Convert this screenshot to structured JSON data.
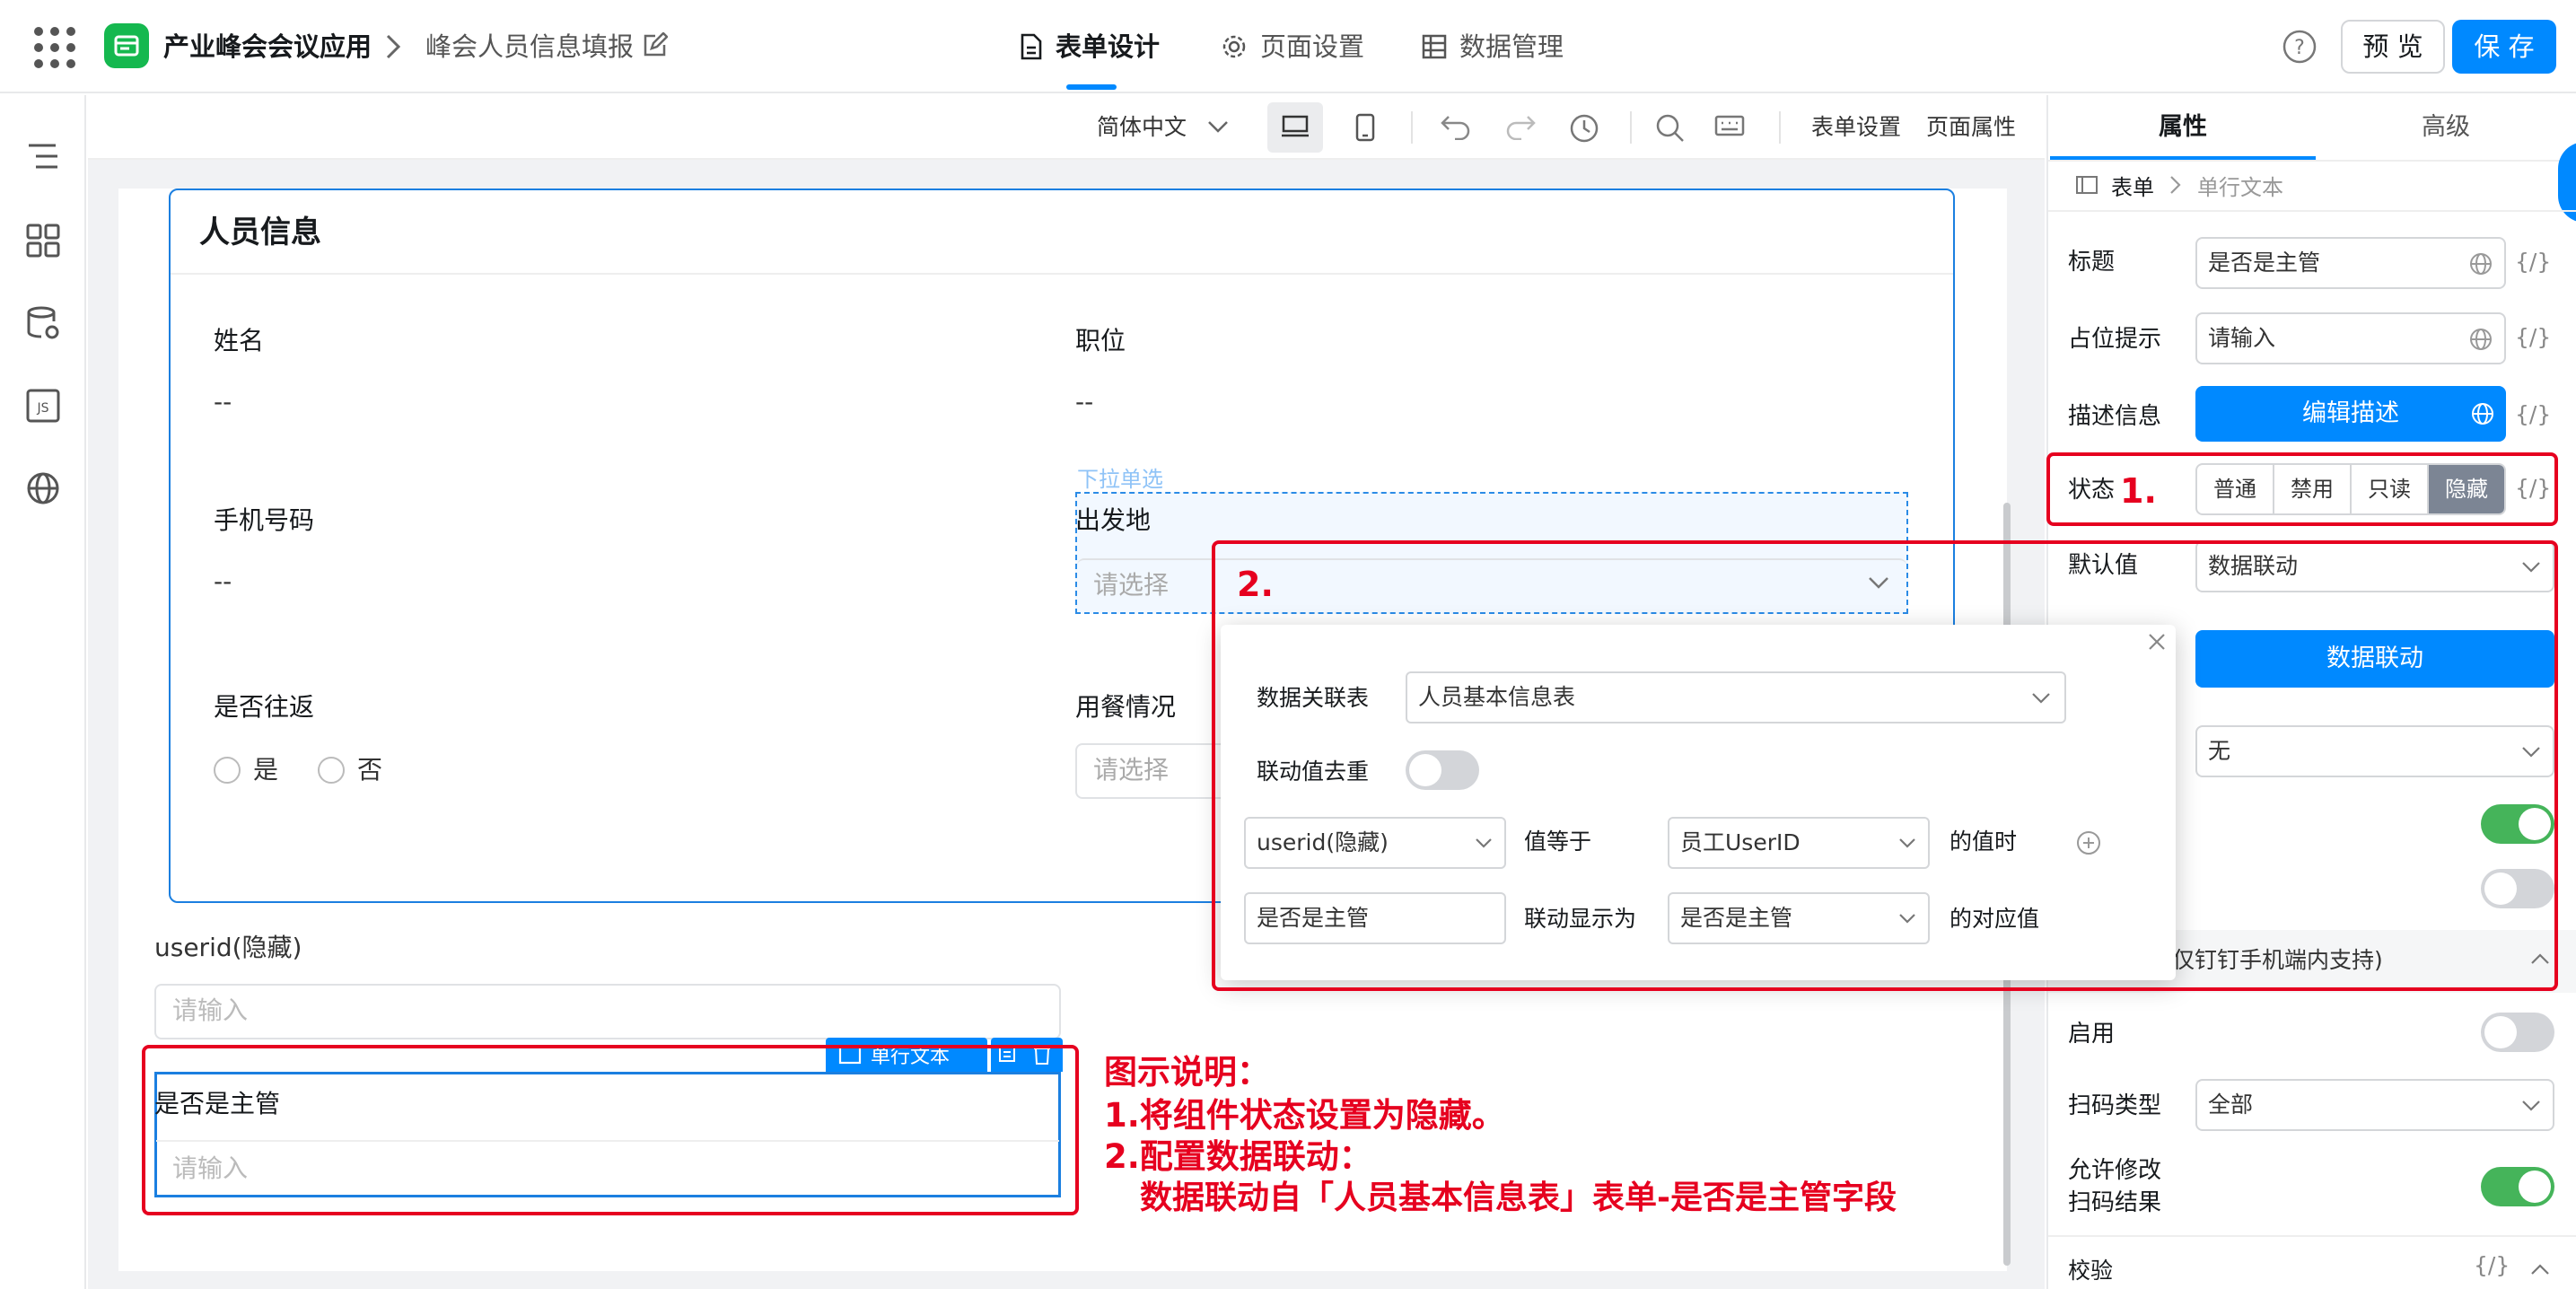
{
  "header": {
    "app_name": "产业峰会会议应用",
    "form_name": "峰会人员信息填报",
    "tabs": [
      {
        "label": "表单设计"
      },
      {
        "label": "页面设置"
      },
      {
        "label": "数据管理"
      }
    ],
    "preview_label": "预 览",
    "save_label": "保 存"
  },
  "toolbar": {
    "language": "简体中文",
    "form_settings": "表单设置",
    "page_properties": "页面属性"
  },
  "form": {
    "group_title": "人员信息",
    "name_label": "姓名",
    "name_value": "--",
    "position_label": "职位",
    "position_value": "--",
    "phone_label": "手机号码",
    "phone_value": "--",
    "dropdown_hint": "下拉单选",
    "departure_label": "出发地",
    "select_placeholder": "请选择",
    "roundtrip_label": "是否往返",
    "radio_yes": "是",
    "radio_no": "否",
    "meal_label": "用餐情况",
    "userid_label": "userid(隐藏)",
    "input_placeholder": "请输入",
    "component_badge": "单行文本",
    "manager_label": "是否是主管"
  },
  "props": {
    "tab_props": "属性",
    "tab_advanced": "高级",
    "crumb_form": "表单",
    "crumb_component": "单行文本",
    "title_label": "标题",
    "title_value": "是否是主管",
    "placeholder_label": "占位提示",
    "placeholder_value": "请输入",
    "desc_label": "描述信息",
    "desc_button": "编辑描述",
    "status_label": "状态",
    "status_options": [
      "普通",
      "禁用",
      "只读",
      "隐藏"
    ],
    "status_selected": "隐藏",
    "default_label": "默认值",
    "default_value": "数据联动",
    "linkage_button": "数据联动",
    "none_value": "无",
    "scan_section": "仅钉钉手机端内支持)",
    "enable_label": "启用",
    "scan_type_label": "扫码类型",
    "scan_type_value": "全部",
    "allow_edit_label": "允许修改",
    "allow_edit_label2": "扫码结果",
    "validation_label": "校验",
    "fx": "{/}"
  },
  "popup": {
    "table_label": "数据关联表",
    "table_value": "人员基本信息表",
    "dedupe_label": "联动值去重",
    "cond_field": "userid(隐藏)",
    "cond_op": "值等于",
    "cond_target": "员工UserID",
    "cond_suffix": "的值时",
    "show_field": "是否是主管",
    "show_op": "联动显示为",
    "show_target": "是否是主管",
    "show_suffix": "的对应值"
  },
  "annotation": {
    "marker1": "1.",
    "marker2": "2.",
    "title": "图示说明：",
    "line1": "1.将组件状态设置为隐藏。",
    "line2": "2.配置数据联动：",
    "line3": "数据联动自「人员基本信息表」表单-是否是主管字段"
  },
  "colors": {
    "primary": "#0089ff",
    "app_green": "#15b84f",
    "annotation_red": "#e6001f",
    "selected_segment": "#7c8594",
    "toggle_on": "#45b45a"
  }
}
